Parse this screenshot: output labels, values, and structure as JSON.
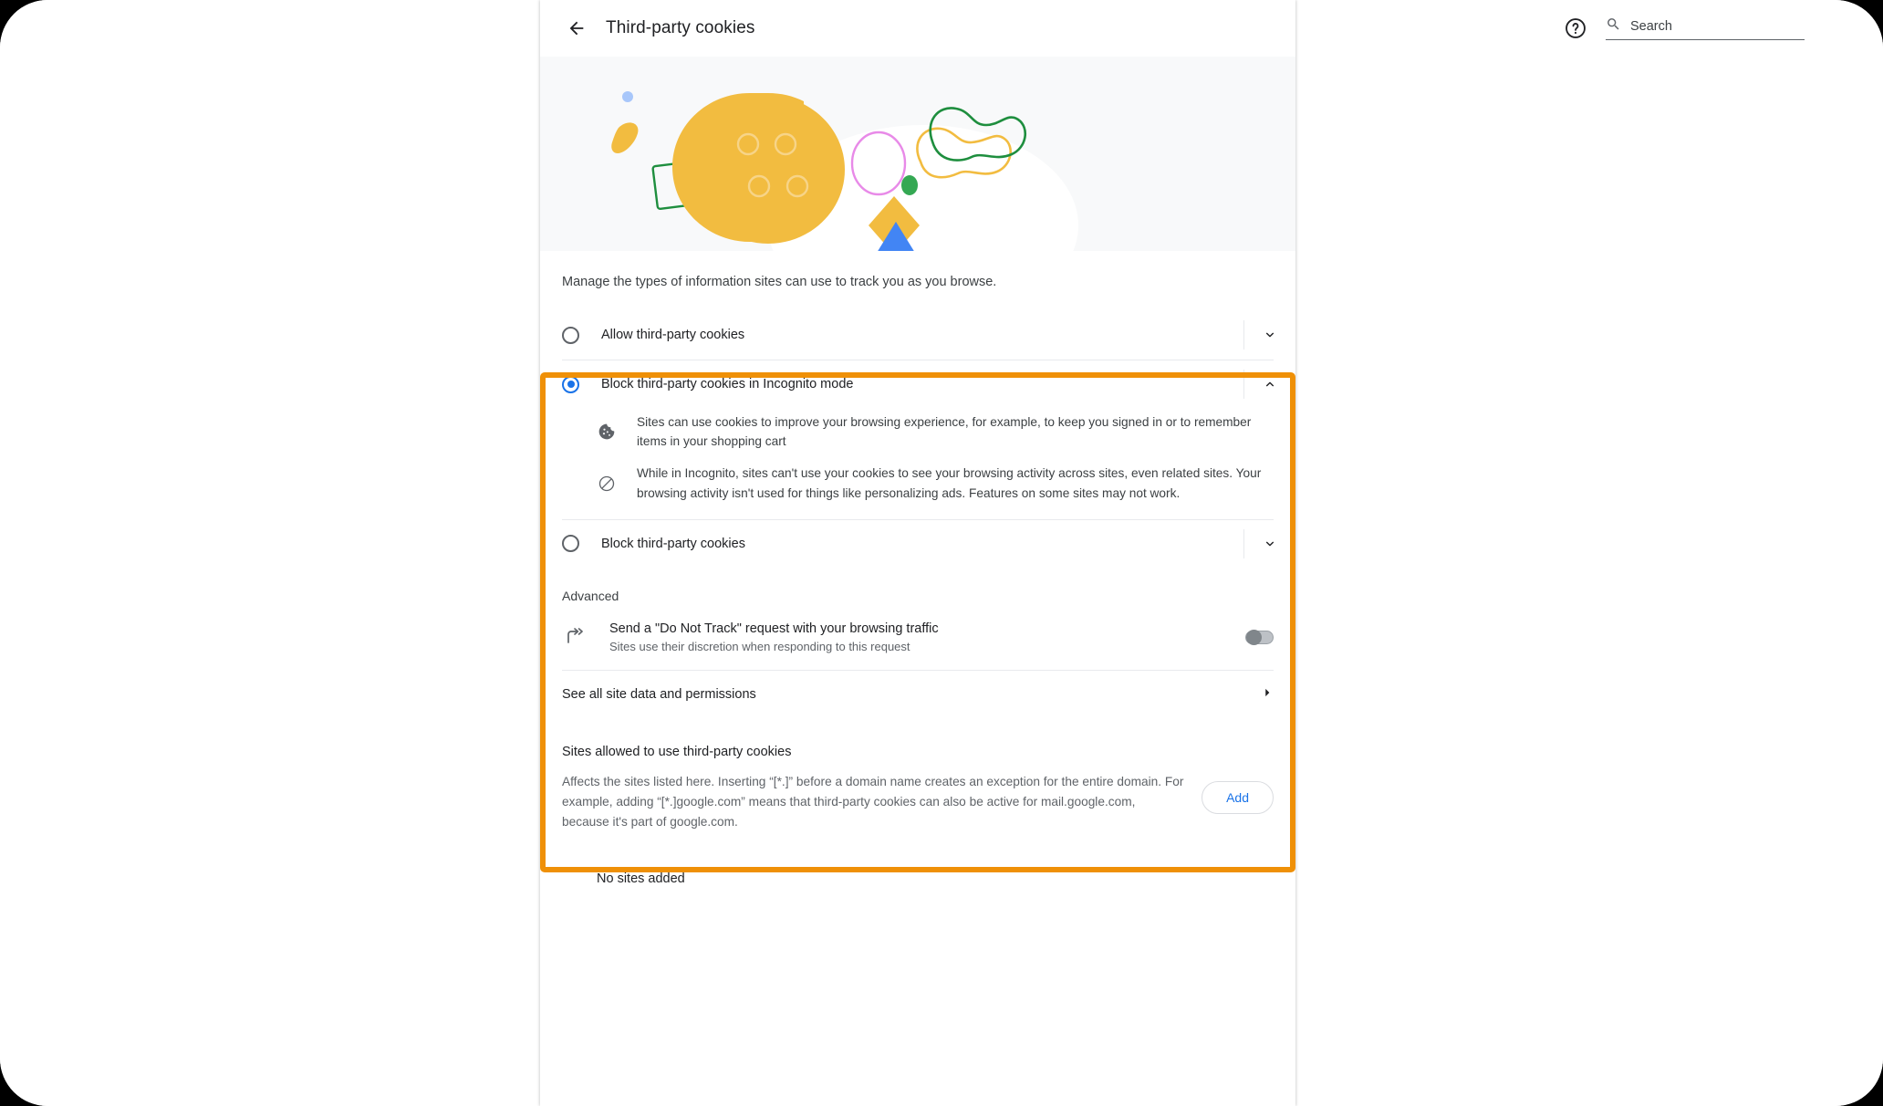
{
  "header": {
    "back_icon": "arrow-back-icon",
    "title": "Third-party cookies",
    "help_icon": "help-circle-icon",
    "search_icon": "search-icon",
    "search_placeholder": "Search",
    "search_value": ""
  },
  "hero": {
    "illustration": "bitten-cookie-illustration",
    "bg_color": "#f8f9fa",
    "cookie_color": "#f2bc40",
    "blue_triangle_color": "#4285f4",
    "green_dot_color": "#34a853",
    "pink_circle_color": "#e88ae8",
    "green_outline_color": "#1e8e3e"
  },
  "intro": "Manage the types of information sites can use to track you as you browse.",
  "highlight": {
    "name": "highlighted-region",
    "color": "#ef9007"
  },
  "options": [
    {
      "label": "Allow third-party cookies",
      "selected": false,
      "expanded": false,
      "chevron": "chevron-down-icon"
    },
    {
      "label": "Block third-party cookies in Incognito mode",
      "selected": true,
      "expanded": true,
      "chevron": "chevron-up-icon",
      "details": [
        {
          "icon": "cookie-icon",
          "text": "Sites can use cookies to improve your browsing experience, for example, to keep you signed in or to remember items in your shopping cart"
        },
        {
          "icon": "block-icon",
          "text": "While in Incognito, sites can't use your cookies to see your browsing activity across sites, even related sites. Your browsing activity isn't used for things like personalizing ads. Features on some sites may not work."
        }
      ]
    },
    {
      "label": "Block third-party cookies",
      "selected": false,
      "expanded": false,
      "chevron": "chevron-down-icon"
    }
  ],
  "advanced": {
    "heading": "Advanced",
    "do_not_track": {
      "icon": "redirect-arrow-icon",
      "title": "Send a \"Do Not Track\" request with your browsing traffic",
      "subtitle": "Sites use their discretion when responding to this request",
      "toggle_on": false
    }
  },
  "see_all": {
    "label": "See all site data and permissions",
    "arrow_icon": "arrow-right-icon"
  },
  "sites_section": {
    "title": "Sites allowed to use third-party cookies",
    "description": "Affects the sites listed here. Inserting “[*.]” before a domain name creates an exception for the entire domain. For example, adding “[*.]google.com” means that third-party cookies can also be active for mail.google.com, because it's part of google.com.",
    "add_label": "Add",
    "empty_text": "No sites added"
  }
}
